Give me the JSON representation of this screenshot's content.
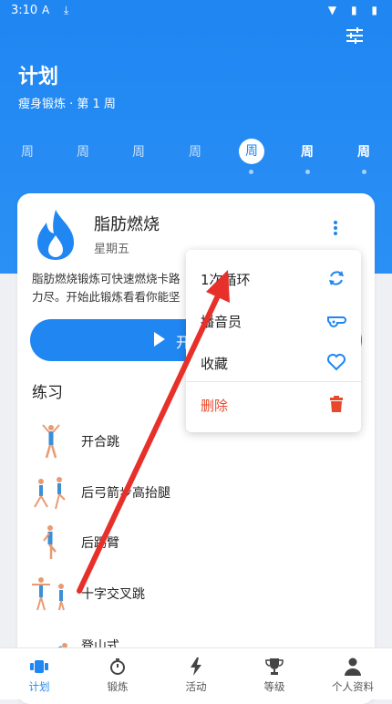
{
  "status": {
    "time": "3:10",
    "icons": "A ⤓",
    "right_icons": "▼ ▮ ▮"
  },
  "header": {
    "title": "计划",
    "subtitle": "瘦身锻炼 · 第 1 周",
    "filter_icon": "sliders-icon"
  },
  "weeks": [
    {
      "label": "周",
      "state": "inactive"
    },
    {
      "label": "周",
      "state": "inactive"
    },
    {
      "label": "周",
      "state": "inactive"
    },
    {
      "label": "周",
      "state": "inactive"
    },
    {
      "label": "周",
      "state": "active"
    },
    {
      "label": "周",
      "state": "bold"
    },
    {
      "label": "周",
      "state": "bold"
    }
  ],
  "card": {
    "title": "脂肪燃烧",
    "subtitle": "星期五",
    "description_line1": "脂肪燃烧锻炼可快速燃烧卡路",
    "description_line2": "力尽。开始此锻炼看看你能坚",
    "start_label": "开",
    "section_title": "练习",
    "exercises": [
      {
        "name": "开合跳"
      },
      {
        "name": "后弓箭步高抬腿"
      },
      {
        "name": "后踢臂"
      },
      {
        "name": "十字交叉跳"
      },
      {
        "name": "登山式"
      }
    ]
  },
  "menu": {
    "items": [
      {
        "label": "1次循环",
        "icon": "repeat-icon"
      },
      {
        "label": "播音员",
        "icon": "whistle-icon"
      },
      {
        "label": "收藏",
        "icon": "heart-icon"
      },
      {
        "label": "删除",
        "icon": "trash-icon"
      }
    ]
  },
  "nav": {
    "items": [
      {
        "label": "计划",
        "icon": "plan-icon",
        "active": true
      },
      {
        "label": "锻炼",
        "icon": "stopwatch-icon",
        "active": false
      },
      {
        "label": "活动",
        "icon": "bolt-icon",
        "active": false
      },
      {
        "label": "等级",
        "icon": "trophy-icon",
        "active": false
      },
      {
        "label": "个人资料",
        "icon": "person-icon",
        "active": false
      }
    ]
  },
  "colors": {
    "primary": "#1f86f2",
    "danger": "#e8492d",
    "arrow": "#e8302a"
  }
}
